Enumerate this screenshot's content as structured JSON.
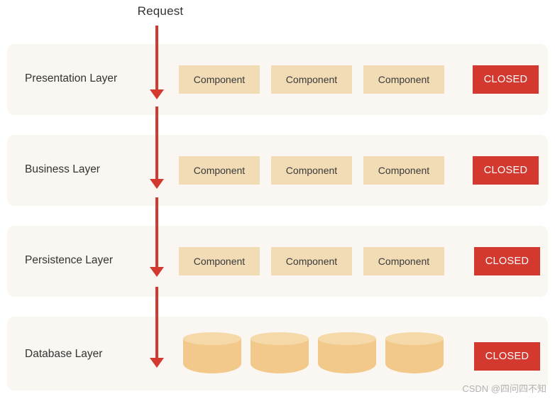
{
  "diagram": {
    "request_label": "Request",
    "watermark": "CSDN @四问四不知",
    "colors": {
      "layer_background": "#faf7f2",
      "component": "#f2dcb5",
      "closed_badge": "#d3392f",
      "arrow": "#d3392f",
      "cylinder_body": "#f2c98a",
      "cylinder_top": "#f6d9a8",
      "text": "#333333"
    },
    "layers": [
      {
        "title": "Presentation Layer",
        "components": [
          "Component",
          "Component",
          "Component"
        ],
        "badge": "CLOSED",
        "type": "components"
      },
      {
        "title": "Business Layer",
        "components": [
          "Component",
          "Component",
          "Component"
        ],
        "badge": "CLOSED",
        "type": "components"
      },
      {
        "title": "Persistence Layer",
        "components": [
          "Component",
          "Component",
          "Component"
        ],
        "badge": "CLOSED",
        "type": "components"
      },
      {
        "title": "Database Layer",
        "components": [
          "",
          "",
          "",
          ""
        ],
        "badge": "CLOSED",
        "type": "cylinders"
      }
    ]
  }
}
